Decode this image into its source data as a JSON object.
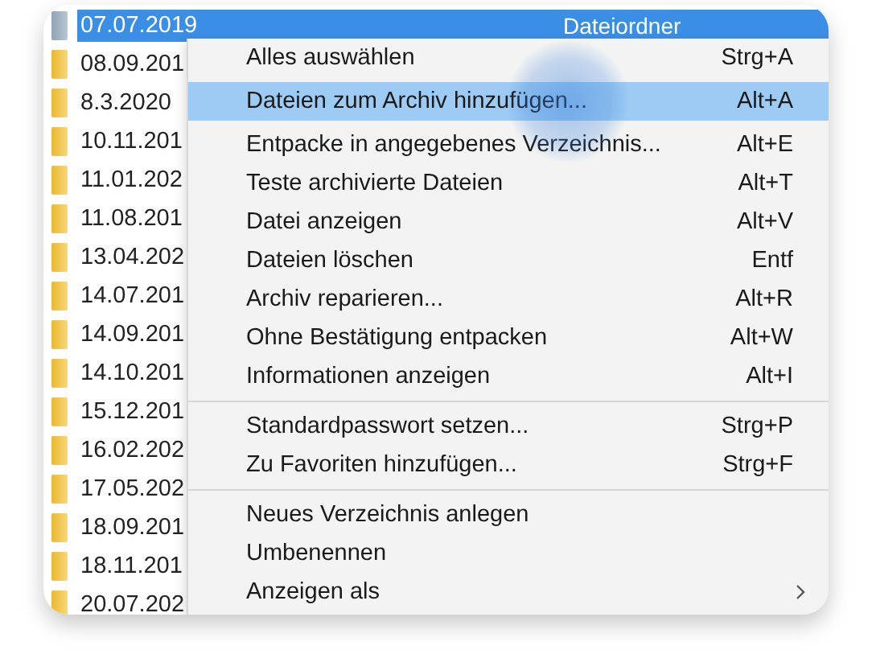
{
  "files": [
    {
      "name": "07.07.2019",
      "type": "Dateiordner",
      "selected": true
    },
    {
      "name": "08.09.201",
      "selected": false
    },
    {
      "name": "8.3.2020",
      "selected": false
    },
    {
      "name": "10.11.201",
      "selected": false
    },
    {
      "name": "11.01.202",
      "selected": false
    },
    {
      "name": "11.08.201",
      "selected": false
    },
    {
      "name": "13.04.202",
      "selected": false
    },
    {
      "name": "14.07.201",
      "selected": false
    },
    {
      "name": "14.09.201",
      "selected": false
    },
    {
      "name": "14.10.201",
      "selected": false
    },
    {
      "name": "15.12.201",
      "selected": false
    },
    {
      "name": "16.02.202",
      "selected": false
    },
    {
      "name": "17.05.202",
      "selected": false
    },
    {
      "name": "18.09.201",
      "selected": false
    },
    {
      "name": "18.11.201",
      "selected": false
    },
    {
      "name": "20.07.202",
      "selected": false
    }
  ],
  "context_menu": {
    "items": [
      {
        "kind": "item",
        "label": "Alles auswählen",
        "shortcut": "Strg+A",
        "selected": false,
        "submenu": false
      },
      {
        "kind": "item",
        "label": "Dateien zum Archiv hinzufügen...",
        "shortcut": "Alt+A",
        "selected": true,
        "submenu": false
      },
      {
        "kind": "item",
        "label": "Entpacke in angegebenes Verzeichnis...",
        "shortcut": "Alt+E",
        "selected": false,
        "submenu": false
      },
      {
        "kind": "item",
        "label": "Teste archivierte Dateien",
        "shortcut": "Alt+T",
        "selected": false,
        "submenu": false
      },
      {
        "kind": "item",
        "label": "Datei anzeigen",
        "shortcut": "Alt+V",
        "selected": false,
        "submenu": false
      },
      {
        "kind": "item",
        "label": "Dateien löschen",
        "shortcut": "Entf",
        "selected": false,
        "submenu": false
      },
      {
        "kind": "item",
        "label": "Archiv reparieren...",
        "shortcut": "Alt+R",
        "selected": false,
        "submenu": false
      },
      {
        "kind": "item",
        "label": "Ohne Bestätigung entpacken",
        "shortcut": "Alt+W",
        "selected": false,
        "submenu": false
      },
      {
        "kind": "item",
        "label": "Informationen anzeigen",
        "shortcut": "Alt+I",
        "selected": false,
        "submenu": false
      },
      {
        "kind": "separator"
      },
      {
        "kind": "item",
        "label": "Standardpasswort setzen...",
        "shortcut": "Strg+P",
        "selected": false,
        "submenu": false
      },
      {
        "kind": "item",
        "label": "Zu Favoriten hinzufügen...",
        "shortcut": "Strg+F",
        "selected": false,
        "submenu": false
      },
      {
        "kind": "separator"
      },
      {
        "kind": "item",
        "label": "Neues Verzeichnis anlegen",
        "selected": false,
        "submenu": false
      },
      {
        "kind": "item",
        "label": "Umbenennen",
        "selected": false,
        "submenu": false
      },
      {
        "kind": "item",
        "label": "Anzeigen als",
        "selected": false,
        "submenu": true
      }
    ]
  }
}
